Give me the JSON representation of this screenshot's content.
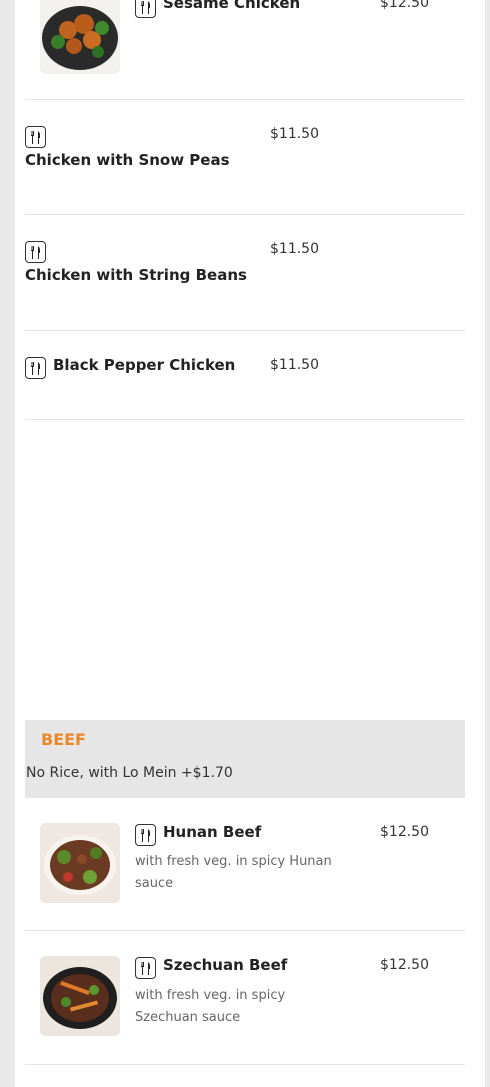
{
  "sections": {
    "chicken_items": [
      {
        "name": "Sesame Chicken",
        "price": "$12.50"
      },
      {
        "name": "Chicken with Snow Peas",
        "price": "$11.50"
      },
      {
        "name": "Chicken with String Beans",
        "price": "$11.50"
      },
      {
        "name": "Black Pepper Chicken",
        "price": "$11.50"
      }
    ],
    "beef": {
      "title": "BEEF",
      "subtitle": "No Rice, with Lo Mein +$1.70",
      "items": [
        {
          "name": "Hunan Beef",
          "price": "$12.50",
          "description": "with fresh veg. in spicy Hunan sauce"
        },
        {
          "name": "Szechuan Beef",
          "price": "$12.50",
          "description": "with fresh veg. in spicy Szechuan sauce"
        }
      ]
    }
  },
  "icons": {
    "menu_item_icon": "fork-knife-icon"
  },
  "colors": {
    "category_title": "#e9872b",
    "category_bg": "#e6e6e6"
  }
}
